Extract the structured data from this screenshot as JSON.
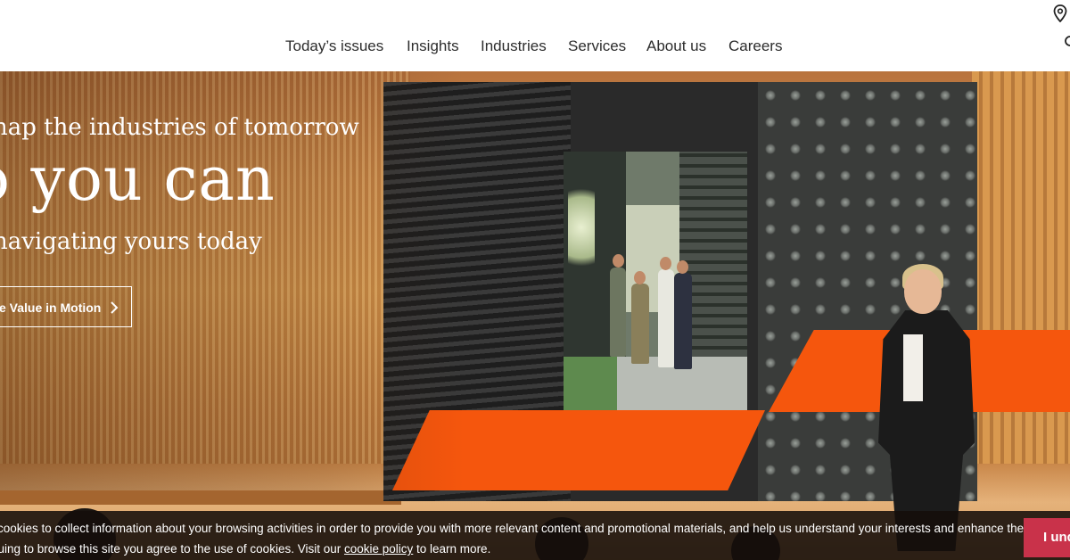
{
  "nav": {
    "items": [
      {
        "label": "Today’s issues"
      },
      {
        "label": "Insights"
      },
      {
        "label": "Industries"
      },
      {
        "label": "Services"
      },
      {
        "label": "About us"
      },
      {
        "label": "Careers"
      }
    ],
    "location_icon": "map-pin-icon",
    "search_icon": "search-icon"
  },
  "hero": {
    "eyebrow": "hap the industries of tomorrow",
    "headline": "o you can",
    "subline": "navigating yours today",
    "cta_label": "e Value in Motion",
    "cta_icon": "chevron-right-icon",
    "accent_color": "#f5560d"
  },
  "cookie": {
    "line1": " cookies to collect information about your browsing activities in order to provide you with more relevant content and promotional materials, and help us understand your interests and enhance the",
    "line2_before": "nuing to browse this site you agree to the use of cookies. Visit our ",
    "link_label": "cookie policy",
    "line2_after": " to learn more.",
    "button_label": "I und",
    "button_color": "#c9324a"
  }
}
